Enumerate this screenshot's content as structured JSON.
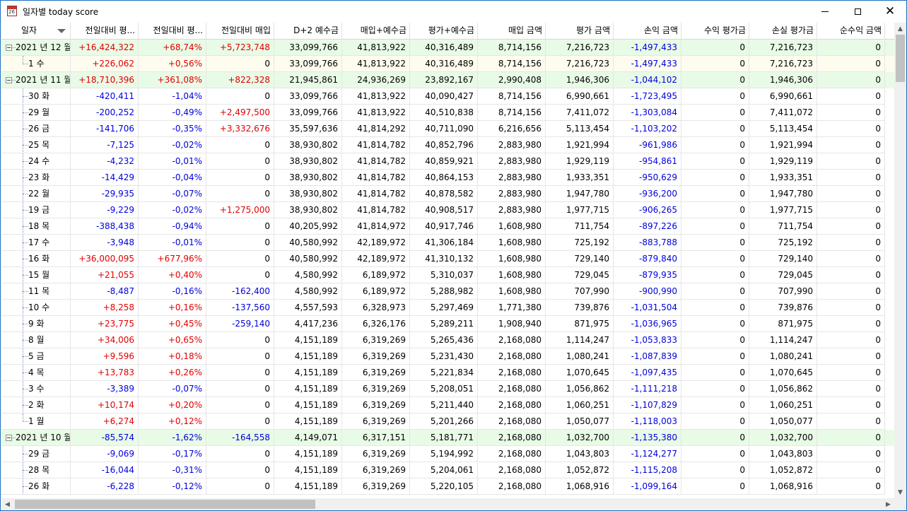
{
  "window": {
    "title": "일자별 today score",
    "icon": "calendar-icon",
    "controls": {
      "minimize": "minimize-icon",
      "maximize": "maximize-icon",
      "close": "close-icon"
    }
  },
  "colors": {
    "positive": "#e00000",
    "negative": "#0000dd",
    "group_row_bg": "#e8fbe6",
    "selected_row_bg": "#fdfcef"
  },
  "columns": [
    "일자",
    "전일대비 평...",
    "전일대비 평...",
    "전일대비 매입",
    "D+2 예수금",
    "매입+예수금",
    "평가+예수금",
    "매입 금액",
    "평가 금액",
    "손익 금액",
    "수익 평가금",
    "손실 평가금",
    "순수익 금액"
  ],
  "sort_column_icon": "sort-desc-icon",
  "rows": [
    {
      "type": "group",
      "label": "2021 년 12 월",
      "cells": [
        "+16,424,322",
        "+68,74%",
        "+5,723,748",
        "33,099,766",
        "41,813,922",
        "40,316,489",
        "8,714,156",
        "7,216,723",
        "-1,497,433",
        "0",
        "7,216,723",
        "0"
      ]
    },
    {
      "type": "child",
      "label": "1 수",
      "last": true,
      "selected": true,
      "cells": [
        "+226,062",
        "+0,56%",
        "0",
        "33,099,766",
        "41,813,922",
        "40,316,489",
        "8,714,156",
        "7,216,723",
        "-1,497,433",
        "0",
        "7,216,723",
        "0"
      ]
    },
    {
      "type": "group",
      "label": "2021 년 11 월",
      "cells": [
        "+18,710,396",
        "+361,08%",
        "+822,328",
        "21,945,861",
        "24,936,269",
        "23,892,167",
        "2,990,408",
        "1,946,306",
        "-1,044,102",
        "0",
        "1,946,306",
        "0"
      ]
    },
    {
      "type": "child",
      "label": "30 화",
      "cells": [
        "-420,411",
        "-1,04%",
        "0",
        "33,099,766",
        "41,813,922",
        "40,090,427",
        "8,714,156",
        "6,990,661",
        "-1,723,495",
        "0",
        "6,990,661",
        "0"
      ]
    },
    {
      "type": "child",
      "label": "29 월",
      "cells": [
        "-200,252",
        "-0,49%",
        "+2,497,500",
        "33,099,766",
        "41,813,922",
        "40,510,838",
        "8,714,156",
        "7,411,072",
        "-1,303,084",
        "0",
        "7,411,072",
        "0"
      ]
    },
    {
      "type": "child",
      "label": "26 금",
      "cells": [
        "-141,706",
        "-0,35%",
        "+3,332,676",
        "35,597,636",
        "41,814,292",
        "40,711,090",
        "6,216,656",
        "5,113,454",
        "-1,103,202",
        "0",
        "5,113,454",
        "0"
      ]
    },
    {
      "type": "child",
      "label": "25 목",
      "cells": [
        "-7,125",
        "-0,02%",
        "0",
        "38,930,802",
        "41,814,782",
        "40,852,796",
        "2,883,980",
        "1,921,994",
        "-961,986",
        "0",
        "1,921,994",
        "0"
      ]
    },
    {
      "type": "child",
      "label": "24 수",
      "cells": [
        "-4,232",
        "-0,01%",
        "0",
        "38,930,802",
        "41,814,782",
        "40,859,921",
        "2,883,980",
        "1,929,119",
        "-954,861",
        "0",
        "1,929,119",
        "0"
      ]
    },
    {
      "type": "child",
      "label": "23 화",
      "cells": [
        "-14,429",
        "-0,04%",
        "0",
        "38,930,802",
        "41,814,782",
        "40,864,153",
        "2,883,980",
        "1,933,351",
        "-950,629",
        "0",
        "1,933,351",
        "0"
      ]
    },
    {
      "type": "child",
      "label": "22 월",
      "cells": [
        "-29,935",
        "-0,07%",
        "0",
        "38,930,802",
        "41,814,782",
        "40,878,582",
        "2,883,980",
        "1,947,780",
        "-936,200",
        "0",
        "1,947,780",
        "0"
      ]
    },
    {
      "type": "child",
      "label": "19 금",
      "cells": [
        "-9,229",
        "-0,02%",
        "+1,275,000",
        "38,930,802",
        "41,814,782",
        "40,908,517",
        "2,883,980",
        "1,977,715",
        "-906,265",
        "0",
        "1,977,715",
        "0"
      ]
    },
    {
      "type": "child",
      "label": "18 목",
      "cells": [
        "-388,438",
        "-0,94%",
        "0",
        "40,205,992",
        "41,814,972",
        "40,917,746",
        "1,608,980",
        "711,754",
        "-897,226",
        "0",
        "711,754",
        "0"
      ]
    },
    {
      "type": "child",
      "label": "17 수",
      "cells": [
        "-3,948",
        "-0,01%",
        "0",
        "40,580,992",
        "42,189,972",
        "41,306,184",
        "1,608,980",
        "725,192",
        "-883,788",
        "0",
        "725,192",
        "0"
      ]
    },
    {
      "type": "child",
      "label": "16 화",
      "cells": [
        "+36,000,095",
        "+677,96%",
        "0",
        "40,580,992",
        "42,189,972",
        "41,310,132",
        "1,608,980",
        "729,140",
        "-879,840",
        "0",
        "729,140",
        "0"
      ]
    },
    {
      "type": "child",
      "label": "15 월",
      "cells": [
        "+21,055",
        "+0,40%",
        "0",
        "4,580,992",
        "6,189,972",
        "5,310,037",
        "1,608,980",
        "729,045",
        "-879,935",
        "0",
        "729,045",
        "0"
      ]
    },
    {
      "type": "child",
      "label": "11 목",
      "cells": [
        "-8,487",
        "-0,16%",
        "-162,400",
        "4,580,992",
        "6,189,972",
        "5,288,982",
        "1,608,980",
        "707,990",
        "-900,990",
        "0",
        "707,990",
        "0"
      ]
    },
    {
      "type": "child",
      "label": "10 수",
      "cells": [
        "+8,258",
        "+0,16%",
        "-137,560",
        "4,557,593",
        "6,328,973",
        "5,297,469",
        "1,771,380",
        "739,876",
        "-1,031,504",
        "0",
        "739,876",
        "0"
      ]
    },
    {
      "type": "child",
      "label": "9 화",
      "cells": [
        "+23,775",
        "+0,45%",
        "-259,140",
        "4,417,236",
        "6,326,176",
        "5,289,211",
        "1,908,940",
        "871,975",
        "-1,036,965",
        "0",
        "871,975",
        "0"
      ]
    },
    {
      "type": "child",
      "label": "8 월",
      "cells": [
        "+34,006",
        "+0,65%",
        "0",
        "4,151,189",
        "6,319,269",
        "5,265,436",
        "2,168,080",
        "1,114,247",
        "-1,053,833",
        "0",
        "1,114,247",
        "0"
      ]
    },
    {
      "type": "child",
      "label": "5 금",
      "cells": [
        "+9,596",
        "+0,18%",
        "0",
        "4,151,189",
        "6,319,269",
        "5,231,430",
        "2,168,080",
        "1,080,241",
        "-1,087,839",
        "0",
        "1,080,241",
        "0"
      ]
    },
    {
      "type": "child",
      "label": "4 목",
      "cells": [
        "+13,783",
        "+0,26%",
        "0",
        "4,151,189",
        "6,319,269",
        "5,221,834",
        "2,168,080",
        "1,070,645",
        "-1,097,435",
        "0",
        "1,070,645",
        "0"
      ]
    },
    {
      "type": "child",
      "label": "3 수",
      "cells": [
        "-3,389",
        "-0,07%",
        "0",
        "4,151,189",
        "6,319,269",
        "5,208,051",
        "2,168,080",
        "1,056,862",
        "-1,111,218",
        "0",
        "1,056,862",
        "0"
      ]
    },
    {
      "type": "child",
      "label": "2 화",
      "cells": [
        "+10,174",
        "+0,20%",
        "0",
        "4,151,189",
        "6,319,269",
        "5,211,440",
        "2,168,080",
        "1,060,251",
        "-1,107,829",
        "0",
        "1,060,251",
        "0"
      ]
    },
    {
      "type": "child",
      "label": "1 월",
      "last": true,
      "cells": [
        "+6,274",
        "+0,12%",
        "0",
        "4,151,189",
        "6,319,269",
        "5,201,266",
        "2,168,080",
        "1,050,077",
        "-1,118,003",
        "0",
        "1,050,077",
        "0"
      ]
    },
    {
      "type": "group",
      "label": "2021 년 10 월",
      "cells": [
        "-85,574",
        "-1,62%",
        "-164,558",
        "4,149,071",
        "6,317,151",
        "5,181,771",
        "2,168,080",
        "1,032,700",
        "-1,135,380",
        "0",
        "1,032,700",
        "0"
      ]
    },
    {
      "type": "child",
      "label": "29 금",
      "cells": [
        "-9,069",
        "-0,17%",
        "0",
        "4,151,189",
        "6,319,269",
        "5,194,992",
        "2,168,080",
        "1,043,803",
        "-1,124,277",
        "0",
        "1,043,803",
        "0"
      ]
    },
    {
      "type": "child",
      "label": "28 목",
      "cells": [
        "-16,044",
        "-0,31%",
        "0",
        "4,151,189",
        "6,319,269",
        "5,204,061",
        "2,168,080",
        "1,052,872",
        "-1,115,208",
        "0",
        "1,052,872",
        "0"
      ]
    },
    {
      "type": "child",
      "label": "26 화",
      "cells": [
        "-6,228",
        "-0,12%",
        "0",
        "4,151,189",
        "6,319,269",
        "5,220,105",
        "2,168,080",
        "1,068,916",
        "-1,099,164",
        "0",
        "1,068,916",
        "0"
      ]
    }
  ]
}
